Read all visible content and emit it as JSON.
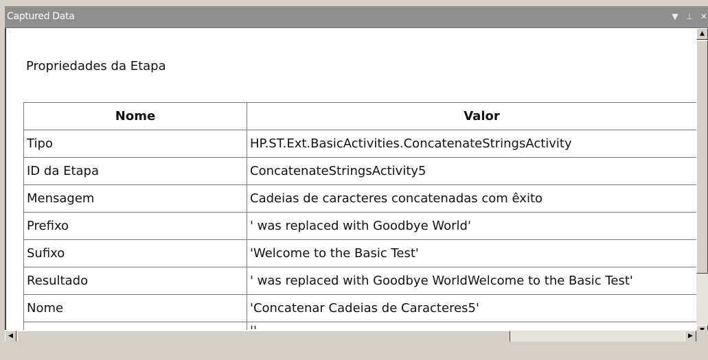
{
  "window": {
    "title": "Captured Data",
    "controls": {
      "dropdown": "▼",
      "pin": "⊥",
      "close": "✕"
    }
  },
  "panel": {
    "heading": "Propriedades da Etapa",
    "columns": {
      "name": "Nome",
      "value": "Valor"
    },
    "rows": [
      {
        "name": "Tipo",
        "value": "HP.ST.Ext.BasicActivities.ConcatenateStringsActivity"
      },
      {
        "name": "ID da Etapa",
        "value": "ConcatenateStringsActivity5"
      },
      {
        "name": "Mensagem",
        "value": "Cadeias de caracteres concatenadas com êxito"
      },
      {
        "name": "Prefixo",
        "value": "' was replaced with Goodbye World'"
      },
      {
        "name": "Sufixo",
        "value": "'Welcome to the Basic Test'"
      },
      {
        "name": "Resultado",
        "value": "' was replaced with Goodbye WorldWelcome to the Basic Test'"
      },
      {
        "name": "Nome",
        "value": "'Concatenar Cadeias de Caracteres5'"
      },
      {
        "name": "Comentário",
        "value": "''"
      }
    ]
  },
  "scrollbars": {
    "up": "▲",
    "down": "▼",
    "left": "◀",
    "right": "▶"
  }
}
